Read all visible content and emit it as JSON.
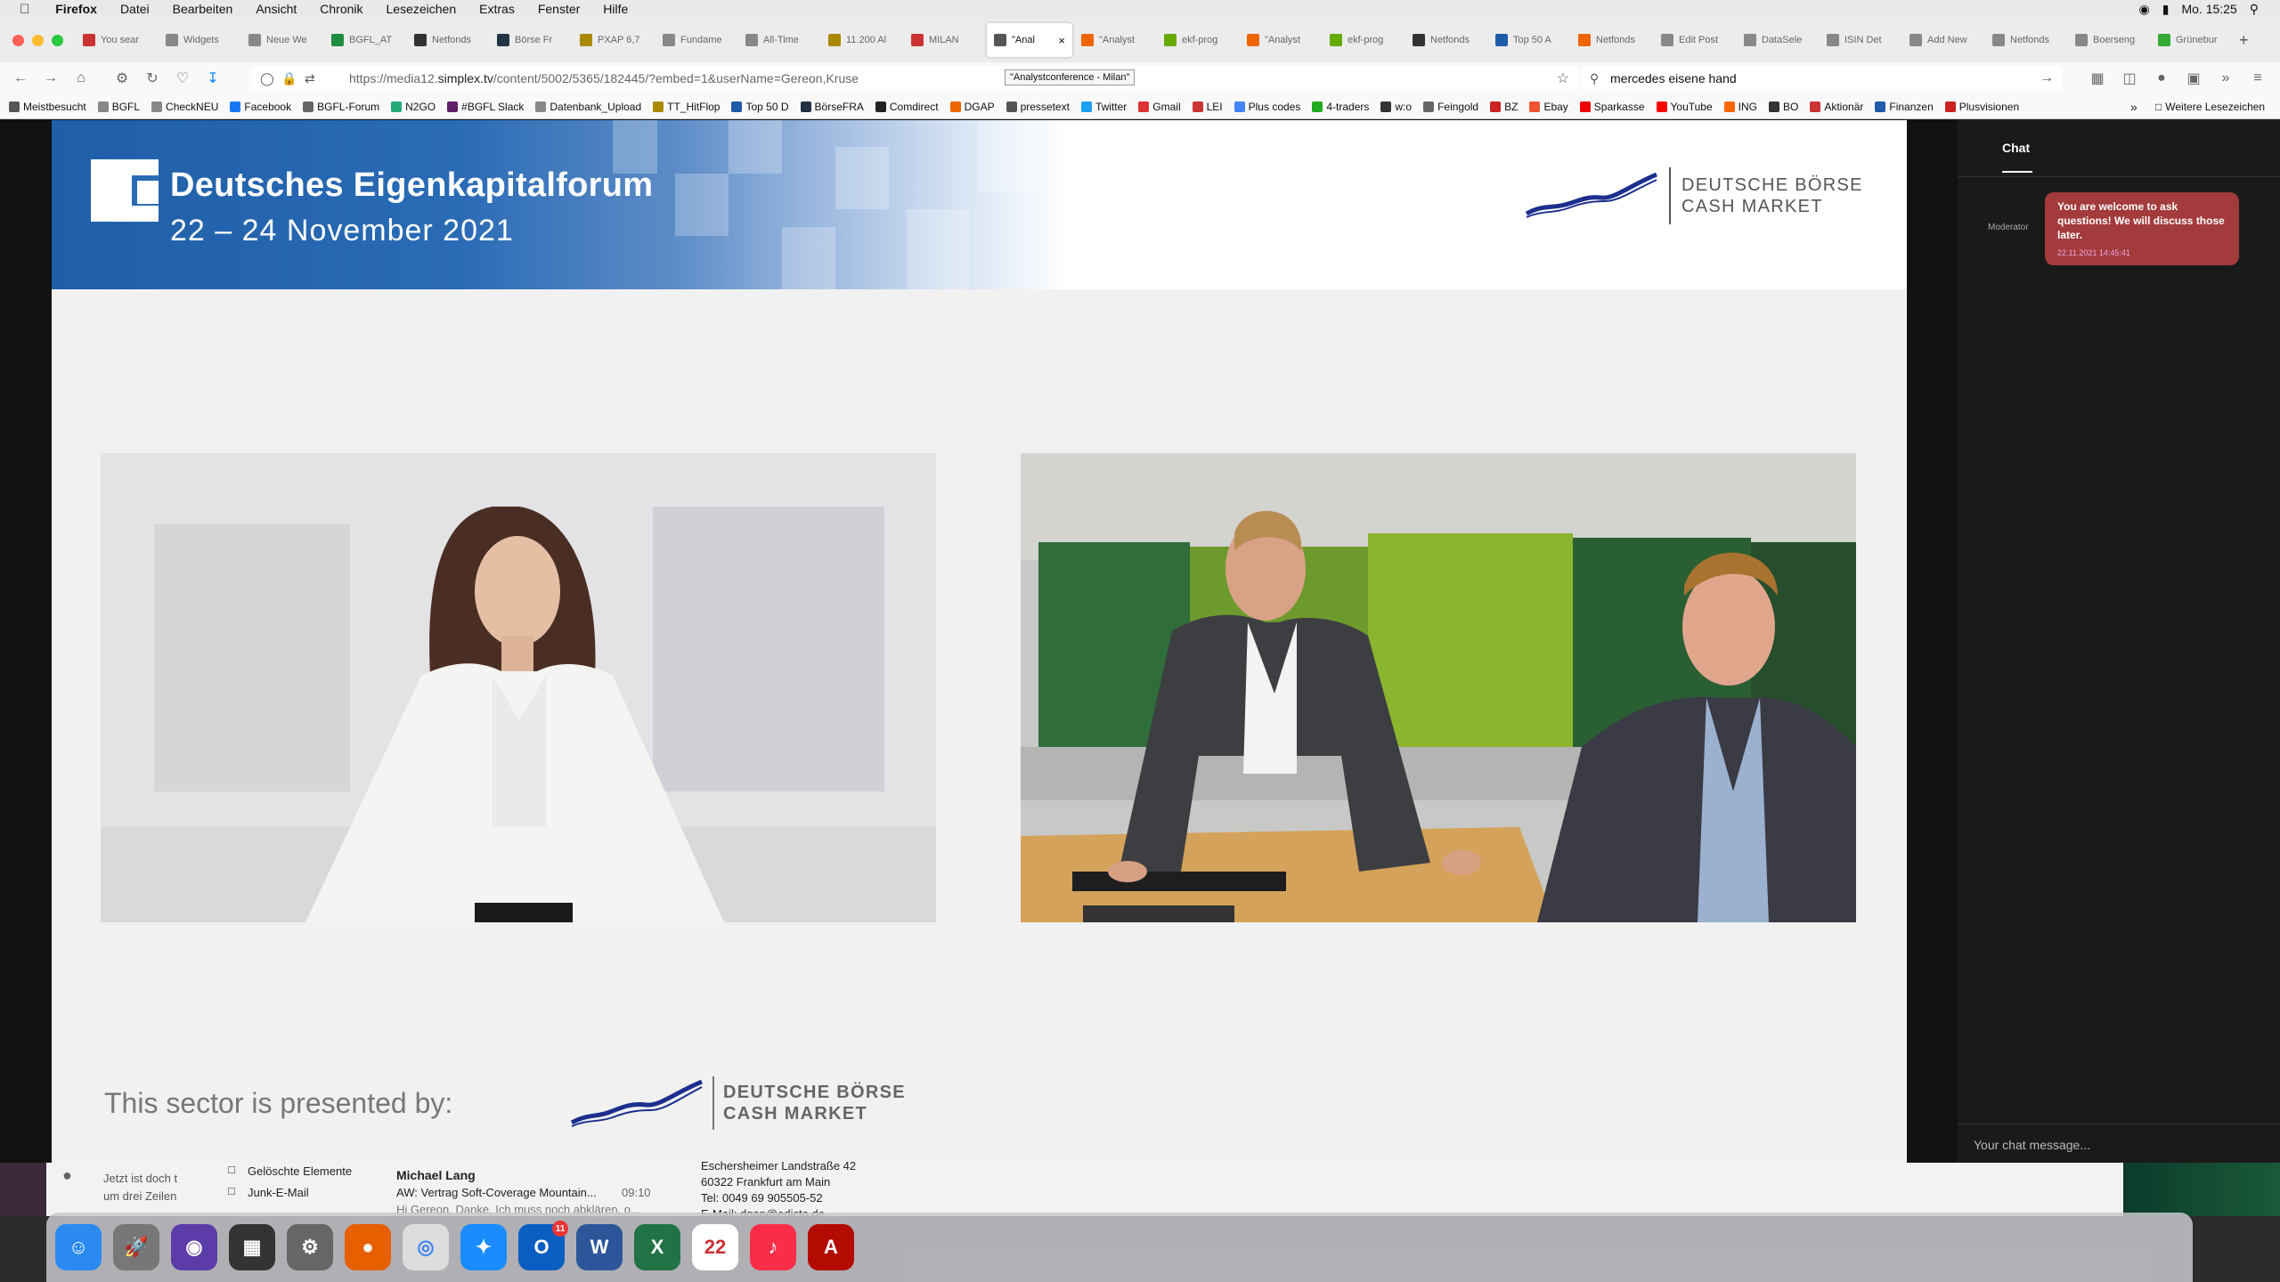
{
  "menubar": {
    "app": "Firefox",
    "items": [
      "Datei",
      "Bearbeiten",
      "Ansicht",
      "Chronik",
      "Lesezeichen",
      "Extras",
      "Fenster",
      "Hilfe"
    ],
    "clock": "Mo. 15:25"
  },
  "tabs": [
    {
      "label": "You sear",
      "color": "#c33"
    },
    {
      "label": "Widgets",
      "color": "#888"
    },
    {
      "label": "Neue We",
      "color": "#888"
    },
    {
      "label": "BGFL_AT",
      "color": "#1e8e3e"
    },
    {
      "label": "Netfonds",
      "color": "#333"
    },
    {
      "label": "Börse Fr",
      "color": "#234"
    },
    {
      "label": "PXAP 6,7",
      "color": "#a80"
    },
    {
      "label": "Fundame",
      "color": "#888"
    },
    {
      "label": "All-Time",
      "color": "#888"
    },
    {
      "label": "11.200 Al",
      "color": "#a80"
    },
    {
      "label": "MILAN",
      "color": "#c33"
    },
    {
      "label": "\"Anal",
      "color": "#555",
      "active": true
    },
    {
      "label": "\"Analyst",
      "color": "#e60"
    },
    {
      "label": "ekf-prog",
      "color": "#6a0"
    },
    {
      "label": "\"Analyst",
      "color": "#e60"
    },
    {
      "label": "ekf-prog",
      "color": "#6a0"
    },
    {
      "label": "Netfonds",
      "color": "#333"
    },
    {
      "label": "Top 50 A",
      "color": "#1e5ba8"
    },
    {
      "label": "Netfonds",
      "color": "#e60"
    },
    {
      "label": "Edit Post",
      "color": "#888"
    },
    {
      "label": "DataSele",
      "color": "#888"
    },
    {
      "label": "ISIN Det",
      "color": "#888"
    },
    {
      "label": "Add New",
      "color": "#888"
    },
    {
      "label": "Netfonds",
      "color": "#888"
    },
    {
      "label": "Boerseng",
      "color": "#888"
    },
    {
      "label": "Grünebur",
      "color": "#3a3"
    }
  ],
  "tooltip": "\"Analystconference - Milan\"",
  "navbar": {
    "url_prefix": "https://media12.",
    "url_domain": "simplex.tv",
    "url_path": "/content/5002/5365/182445/?embed=1&userName=Gereon,Kruse",
    "search_value": "mercedes eisene hand"
  },
  "bookmarks": [
    {
      "label": "Meistbesucht",
      "color": "#555"
    },
    {
      "label": "BGFL",
      "color": "#888"
    },
    {
      "label": "CheckNEU",
      "color": "#888"
    },
    {
      "label": "Facebook",
      "color": "#1877f2"
    },
    {
      "label": "BGFL-Forum",
      "color": "#666"
    },
    {
      "label": "N2GO",
      "color": "#2a7"
    },
    {
      "label": "#BGFL Slack",
      "color": "#611f69"
    },
    {
      "label": "Datenbank_Upload",
      "color": "#888"
    },
    {
      "label": "TT_HitFlop",
      "color": "#a80"
    },
    {
      "label": "Top 50 D",
      "color": "#1e5ba8"
    },
    {
      "label": "BörseFRA",
      "color": "#234"
    },
    {
      "label": "Comdirect",
      "color": "#222"
    },
    {
      "label": "DGAP",
      "color": "#e60"
    },
    {
      "label": "pressetext",
      "color": "#555"
    },
    {
      "label": "Twitter",
      "color": "#1da1f2"
    },
    {
      "label": "Gmail",
      "color": "#d33"
    },
    {
      "label": "LEI",
      "color": "#c33"
    },
    {
      "label": "Plus codes",
      "color": "#4285f4"
    },
    {
      "label": "4-traders",
      "color": "#2a2"
    },
    {
      "label": "w:o",
      "color": "#333"
    },
    {
      "label": "Feingold",
      "color": "#666"
    },
    {
      "label": "BZ",
      "color": "#c22"
    },
    {
      "label": "Ebay",
      "color": "#e53"
    },
    {
      "label": "Sparkasse",
      "color": "#e00"
    },
    {
      "label": "YouTube",
      "color": "#f00"
    },
    {
      "label": "ING",
      "color": "#f60"
    },
    {
      "label": "BO",
      "color": "#333"
    },
    {
      "label": "Aktionär",
      "color": "#c33"
    },
    {
      "label": "Finanzen",
      "color": "#1e5ba8"
    },
    {
      "label": "Plusvisionen",
      "color": "#c22"
    }
  ],
  "bookmarks_more": "Weitere Lesezeichen",
  "banner": {
    "title": "Deutsches Eigenkapitalforum",
    "dates": "22 – 24 November 2021",
    "brand_line1": "DEUTSCHE BÖRSE",
    "brand_line2": "CASH MARKET"
  },
  "sponsor": {
    "text": "This sector is presented by:",
    "brand_line1": "DEUTSCHE BÖRSE",
    "brand_line2": "CASH MARKET"
  },
  "chat": {
    "tab": "Chat",
    "sender": "Moderator",
    "message": "You are welcome to ask questions! We will discuss those later.",
    "timestamp": "22.11.2021 14:45:41",
    "input_placeholder": "Your chat message..."
  },
  "mail_behind": {
    "item1": "Gelöschte Elemente",
    "item2": "Junk-E-Mail",
    "preview_left1": "Jetzt ist doch t",
    "preview_left2": "um drei Zeilen",
    "sender": "Michael Lang",
    "subject": "AW: Vertrag Soft-Coverage Mountain...",
    "time": "09:10",
    "snippet": "Hi Gereon, Danke. Ich muss noch abklären, o...",
    "addr1": "Eschersheimer Landstraße 42",
    "addr2": "60322 Frankfurt am Main",
    "addr3": "Tel: 0049 69 905505-52",
    "addr4": "E-Mail: dgap@edicto.de"
  },
  "dock": [
    {
      "name": "finder",
      "color": "#2b8af0",
      "glyph": "☺"
    },
    {
      "name": "launchpad",
      "color": "#777",
      "glyph": "🚀"
    },
    {
      "name": "siri",
      "color": "#5b3ca8",
      "glyph": "◉"
    },
    {
      "name": "mission-control",
      "color": "#333",
      "glyph": "▦"
    },
    {
      "name": "system-preferences",
      "color": "#666",
      "glyph": "⚙"
    },
    {
      "name": "firefox",
      "color": "#e66000",
      "glyph": "●"
    },
    {
      "name": "chrome",
      "color": "#ddd",
      "glyph": "◎"
    },
    {
      "name": "safari",
      "color": "#1a8cff",
      "glyph": "✦"
    },
    {
      "name": "outlook",
      "color": "#0a5ec2",
      "glyph": "O",
      "badge": "11"
    },
    {
      "name": "word",
      "color": "#2b579a",
      "glyph": "W"
    },
    {
      "name": "excel",
      "color": "#217346",
      "glyph": "X"
    },
    {
      "name": "calendar",
      "color": "#fff",
      "glyph": "22"
    },
    {
      "name": "music",
      "color": "#fa2d48",
      "glyph": "♪"
    },
    {
      "name": "acrobat",
      "color": "#b30b00",
      "glyph": "A"
    }
  ]
}
